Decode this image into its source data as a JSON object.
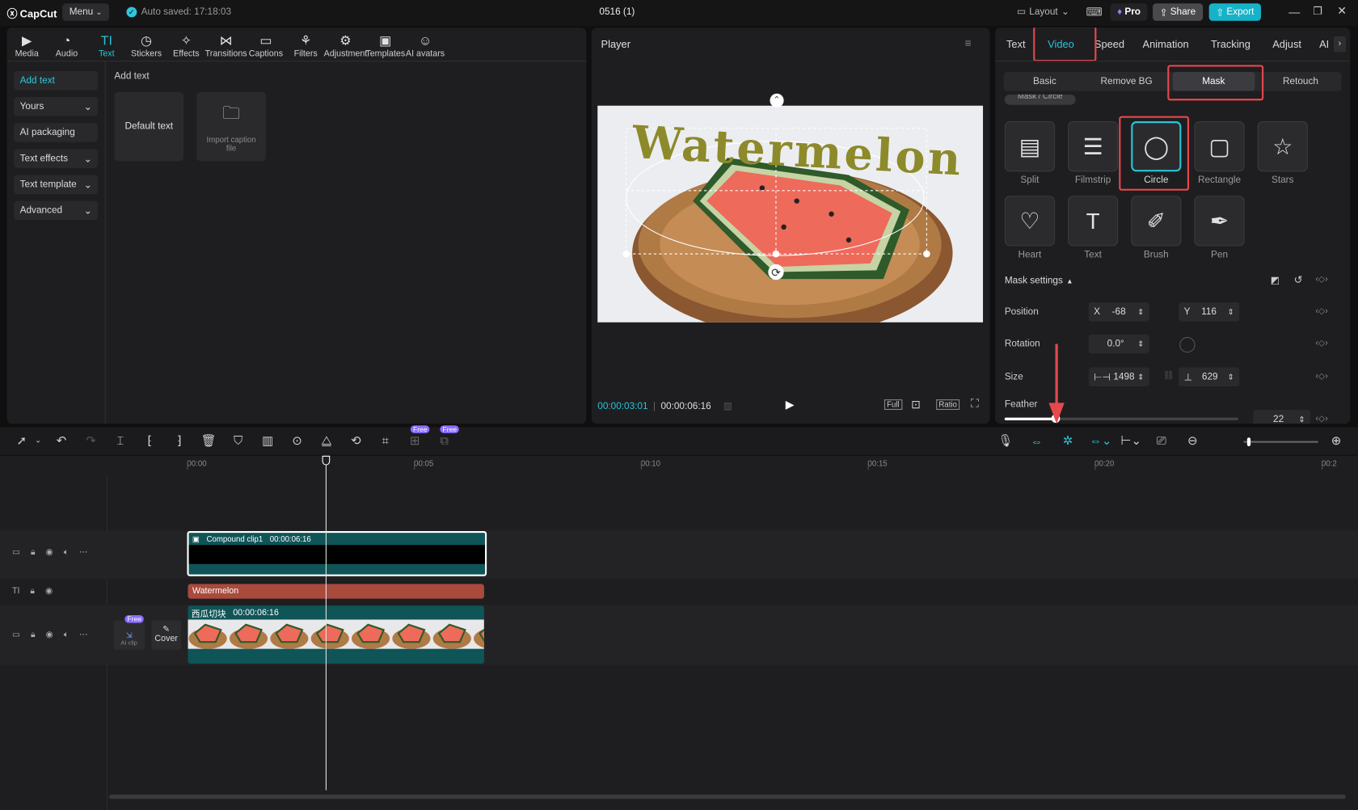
{
  "titlebar": {
    "logo": "CapCut",
    "menu": "Menu",
    "autosave": "Auto saved: 17:18:03",
    "project": "0516 (1)",
    "layout": "Layout",
    "pro": "Pro",
    "share": "Share",
    "export": "Export"
  },
  "toolbar": [
    {
      "label": "Media",
      "icon": "media-icon",
      "glyph": "▶"
    },
    {
      "label": "Audio",
      "icon": "audio-icon",
      "glyph": "◔"
    },
    {
      "label": "Text",
      "icon": "text-icon",
      "glyph": "TI"
    },
    {
      "label": "Stickers",
      "icon": "stickers-icon",
      "glyph": "◷"
    },
    {
      "label": "Effects",
      "icon": "effects-icon",
      "glyph": "✧"
    },
    {
      "label": "Transitions",
      "icon": "transitions-icon",
      "glyph": "⋈"
    },
    {
      "label": "Captions",
      "icon": "captions-icon",
      "glyph": "▭"
    },
    {
      "label": "Filters",
      "icon": "filters-icon",
      "glyph": "⚘"
    },
    {
      "label": "Adjustment",
      "icon": "adjustment-icon",
      "glyph": "⚙"
    },
    {
      "label": "Templates",
      "icon": "templates-icon",
      "glyph": "▣"
    },
    {
      "label": "AI avatars",
      "icon": "ai-avatars-icon",
      "glyph": "☺"
    }
  ],
  "sidebar": {
    "items": [
      {
        "label": "Add text",
        "caret": ""
      },
      {
        "label": "Yours",
        "caret": "⌄"
      },
      {
        "label": "AI packaging",
        "caret": ""
      },
      {
        "label": "Text effects",
        "caret": "⌄"
      },
      {
        "label": "Text template",
        "caret": "⌄"
      },
      {
        "label": "Advanced",
        "caret": "⌄"
      }
    ]
  },
  "content": {
    "heading": "Add text",
    "default_text": "Default text",
    "import_caption": "Import caption file"
  },
  "player": {
    "title": "Player",
    "overlay_text": "Watermelon",
    "current_time": "00:00:03:01",
    "total_time": "00:00:06:16",
    "full": "Full",
    "ratio": "Ratio"
  },
  "right": {
    "tabs": [
      "Text",
      "Video",
      "Speed",
      "Animation",
      "Tracking",
      "Adjust",
      "AI"
    ],
    "subtabs": [
      "Basic",
      "Remove BG",
      "Mask",
      "Retouch"
    ],
    "partial": "Mask / Circle",
    "masks": [
      {
        "label": "Split",
        "icon": "split-mask-icon"
      },
      {
        "label": "Filmstrip",
        "icon": "filmstrip-mask-icon"
      },
      {
        "label": "Circle",
        "icon": "circle-mask-icon"
      },
      {
        "label": "Rectangle",
        "icon": "rectangle-mask-icon"
      },
      {
        "label": "Stars",
        "icon": "stars-mask-icon"
      },
      {
        "label": "Heart",
        "icon": "heart-mask-icon"
      },
      {
        "label": "Text",
        "icon": "text-mask-icon"
      },
      {
        "label": "Brush",
        "icon": "brush-mask-icon"
      },
      {
        "label": "Pen",
        "icon": "pen-mask-icon"
      }
    ],
    "settings": {
      "title": "Mask settings",
      "position": "Position",
      "x_label": "X",
      "x": "-68",
      "y_label": "Y",
      "y": "116",
      "rotation": "Rotation",
      "rotation_val": "0.0°",
      "size": "Size",
      "w": "1498",
      "h": "629",
      "feather": "Feather",
      "feather_val": "22",
      "feather_level": 0.22
    }
  },
  "timeline": {
    "ruler": [
      "00:00",
      "00:05",
      "00:10",
      "00:15",
      "00:20",
      "00:2"
    ],
    "free_badge": "Free",
    "compound_clip": "Compound clip1",
    "compound_dur": "00:00:06:16",
    "text_clip": "Watermelon",
    "video_clip": "西瓜切块",
    "video_dur": "00:00:06:16",
    "ai_clip": "AI clip",
    "cover": "Cover"
  },
  "colors": {
    "accent": "#27c5d8",
    "red": "#e5484d",
    "text_clip": "#a94a3c",
    "video_clip": "#0f5457"
  }
}
